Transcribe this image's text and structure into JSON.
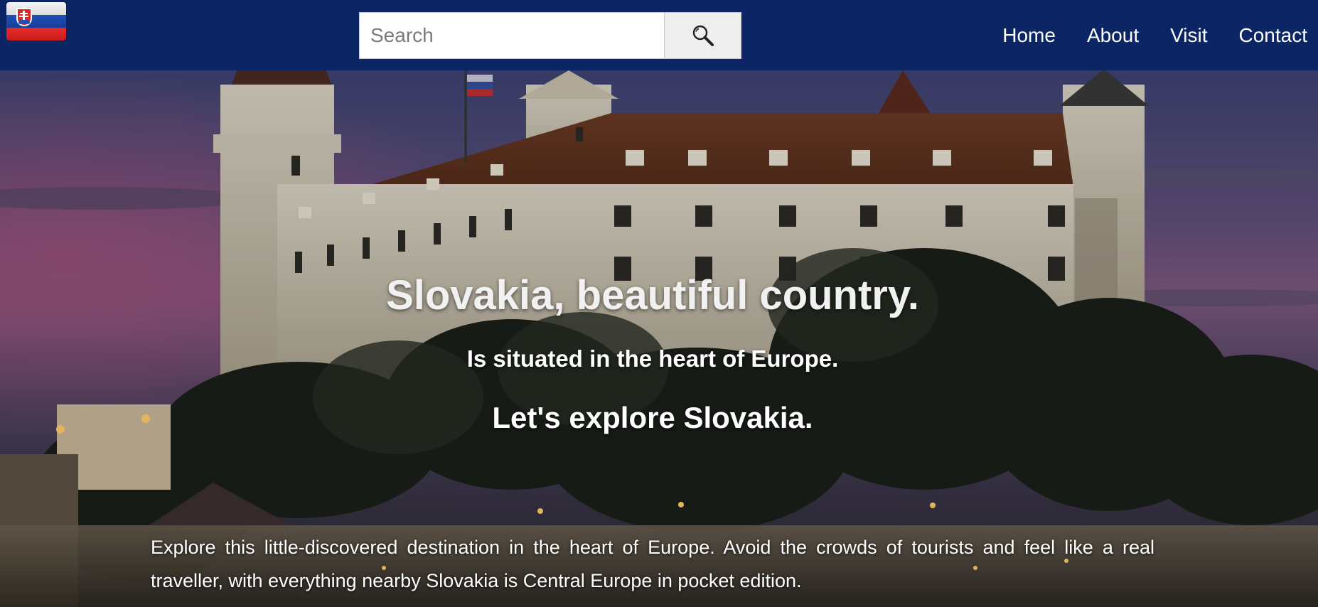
{
  "header": {
    "logo_icon": "slovak-flag-icon",
    "search": {
      "placeholder": "Search",
      "value": "",
      "button_icon": "magnifier-icon"
    },
    "nav": [
      {
        "label": "Home"
      },
      {
        "label": "About"
      },
      {
        "label": "Visit"
      },
      {
        "label": "Contact"
      }
    ]
  },
  "hero": {
    "background_icon": "bratislava-castle-photo",
    "title": "Slovakia, beautiful country.",
    "subtitle": "Is situated in the heart of Europe.",
    "tagline": "Let's explore Slovakia.",
    "description": "Explore this little-discovered destination in the heart of Europe. Avoid the crowds of tourists and feel like a real traveller, with everything nearby Slovakia is Central Europe in pocket edition."
  },
  "colors": {
    "header_bg": "#0b2565",
    "nav_text": "#ffffff",
    "search_button_bg": "#eeeeee"
  }
}
